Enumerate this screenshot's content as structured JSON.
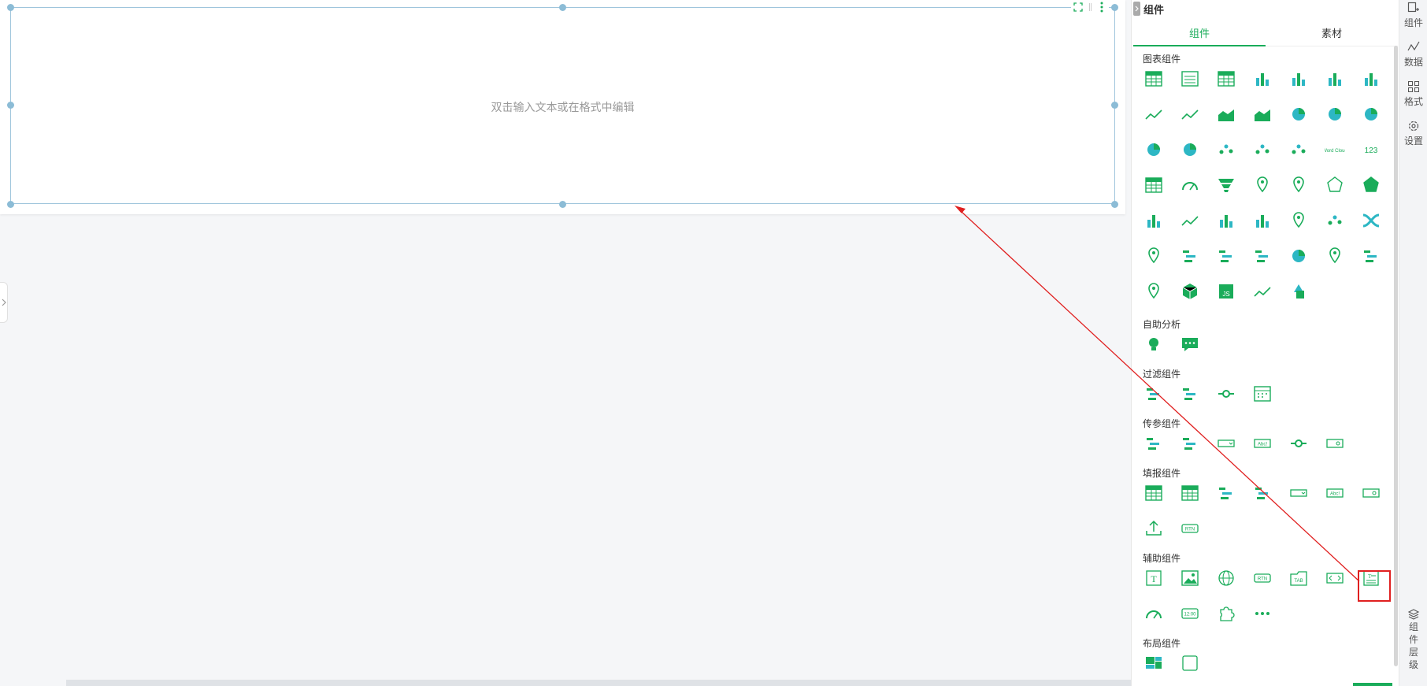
{
  "canvas": {
    "placeholder": "双击输入文本或在格式中编辑"
  },
  "panel": {
    "title": "组件",
    "tabs": [
      {
        "label": "组件",
        "active": true
      },
      {
        "label": "素材",
        "active": false
      }
    ],
    "sections": [
      {
        "title": "图表组件",
        "icons": [
          "table-icon",
          "crosstab-icon",
          "grouped-table-icon",
          "bar-chart-icon",
          "stacked-bar-icon",
          "combo-bar-icon",
          "stacked-column-icon",
          "line-chart-icon",
          "multi-line-icon",
          "area-chart-icon",
          "stacked-area-icon",
          "pie-chart-icon",
          "3d-pie-icon",
          "donut-chart-icon",
          "rose-chart-icon",
          "ring-progress-icon",
          "scatter-icon",
          "dot-matrix-icon",
          "bubble-chart-icon",
          "word-cloud-icon",
          "kpi-number-icon",
          "number-table-icon",
          "gauge-icon",
          "funnel-icon",
          "world-map-icon",
          "map-marker-icon",
          "radar-icon",
          "filled-radar-icon",
          "waterfall-icon",
          "step-line-icon",
          "histogram-icon",
          "boxplot-icon",
          "treemap-icon",
          "network-graph-icon",
          "sankey-icon",
          "heat-map-icon",
          "tree-diagram-icon",
          "gantt-icon",
          "list-chart-icon",
          "globe-icon",
          "location-pin-icon",
          "candlestick-icon",
          "route-map-icon",
          "3d-cube-icon",
          "js-chart-icon",
          "trend-scatter-icon",
          "shapes-icon"
        ]
      },
      {
        "title": "自助分析",
        "icons": [
          "insight-bulb-icon",
          "chat-analysis-icon"
        ]
      },
      {
        "title": "过滤组件",
        "icons": [
          "filter-list-icon",
          "filter-tree-icon",
          "filter-slider-icon",
          "filter-date-icon"
        ]
      },
      {
        "title": "传参组件",
        "icons": [
          "param-list-icon",
          "param-tree-icon",
          "param-dropdown-icon",
          "param-text-icon",
          "param-range-icon",
          "param-search-icon"
        ]
      },
      {
        "title": "填报组件",
        "icons": [
          "fill-table-icon",
          "fill-edit-table-icon",
          "fill-list-icon",
          "fill-tree-icon",
          "fill-dropdown-icon",
          "fill-text-icon",
          "fill-search-icon",
          "upload-icon",
          "fill-button-icon"
        ]
      },
      {
        "title": "辅助组件",
        "icons": [
          "text-box-icon",
          "image-icon",
          "web-page-icon",
          "button-icon",
          "tab-container-icon",
          "code-embed-icon",
          "rich-text-icon",
          "timer-icon",
          "clock-icon",
          "plugin-icon",
          "more-icon"
        ]
      },
      {
        "title": "布局组件",
        "icons": [
          "layout-grid-icon",
          "layout-container-icon"
        ]
      }
    ],
    "labels": {
      "btn_text": "RTN",
      "tab_text": "TAB",
      "abc_text": "Abc!",
      "clock_text": "12:00",
      "kpi_text": "123",
      "num_text": "12 3",
      "word_text": "Word Cloud",
      "js_text": "JS"
    }
  },
  "rail": {
    "items": [
      {
        "label": "组件",
        "icon": "component-icon"
      },
      {
        "label": "数据",
        "icon": "data-icon"
      },
      {
        "label": "格式",
        "icon": "format-icon"
      },
      {
        "label": "设置",
        "icon": "settings-icon"
      }
    ],
    "layers": [
      "组",
      "件",
      "层",
      "级"
    ]
  },
  "colors": {
    "accent": "#1aac5a",
    "accent2": "#2db7c4",
    "highlight": "#e02020",
    "handle": "#8cbcd6"
  }
}
